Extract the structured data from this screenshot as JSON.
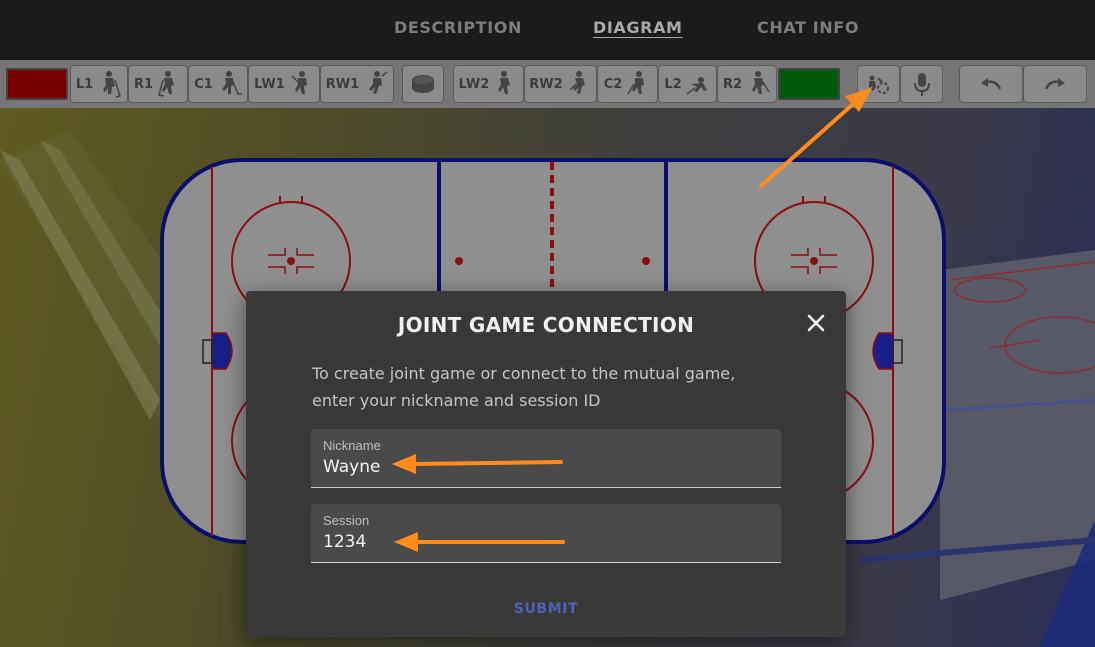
{
  "nav": {
    "tabs": [
      {
        "label": "DESCRIPTION",
        "active": false
      },
      {
        "label": "DIAGRAM",
        "active": true
      },
      {
        "label": "CHAT INFO",
        "active": false
      }
    ]
  },
  "toolbar": {
    "left_team_color": "#7a0000",
    "right_team_color": "#005c0c",
    "left_players": [
      "L1",
      "R1",
      "C1",
      "LW1",
      "RW1"
    ],
    "right_players": [
      "LW2",
      "RW2",
      "C2",
      "L2",
      "R2"
    ],
    "icons": {
      "puck": "puck-icon",
      "play": "play-icon",
      "mic": "microphone-icon",
      "undo": "undo-icon",
      "redo": "redo-icon"
    }
  },
  "modal": {
    "title": "JOINT GAME CONNECTION",
    "description": "To create joint game or connect to the mutual game, enter your nickname and session ID",
    "nickname": {
      "label": "Nickname",
      "value": "Wayne"
    },
    "session": {
      "label": "Session",
      "value": "1234"
    },
    "submit_label": "SUBMIT"
  },
  "colors": {
    "accent": "#4d63b8",
    "annotation_arrow": "#ff8c1a",
    "rink_border": "#0a0f7a",
    "rink_red": "#a11a1a"
  }
}
